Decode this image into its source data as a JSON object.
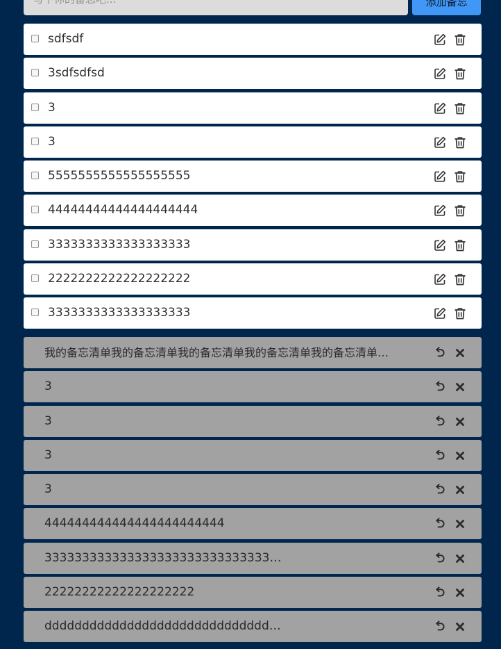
{
  "header": {
    "input_placeholder": "写下你的备忘吧...",
    "add_button_label": "添加备忘"
  },
  "active_notes": [
    {
      "text": "sdfsdf"
    },
    {
      "text": "3sdfsdfsd"
    },
    {
      "text": "3"
    },
    {
      "text": "3"
    },
    {
      "text": "5555555555555555555"
    },
    {
      "text": "44444444444444444444"
    },
    {
      "text": "3333333333333333333"
    },
    {
      "text": "2222222222222222222"
    },
    {
      "text": "3333333333333333333"
    }
  ],
  "completed_notes": [
    {
      "text": "我的备忘清单我的备忘清单我的备忘清单我的备忘清单我的备忘清单…"
    },
    {
      "text": "3"
    },
    {
      "text": "3"
    },
    {
      "text": "3"
    },
    {
      "text": "3"
    },
    {
      "text": "444444444444444444444444"
    },
    {
      "text": "333333333333333333333333333333…"
    },
    {
      "text": "22222222222222222222"
    },
    {
      "text": "dddddddddddddddddddddddddddddd…"
    }
  ],
  "icons": {
    "edit": "pencil-square-icon",
    "delete": "trash-icon",
    "restore": "undo-icon",
    "remove": "close-x-icon"
  },
  "colors": {
    "page_background": "#00264d",
    "add_button": "#4097f5",
    "active_row": "#ffffff",
    "completed_row": "#a3a2a3",
    "input_background": "#dcdcdc"
  }
}
